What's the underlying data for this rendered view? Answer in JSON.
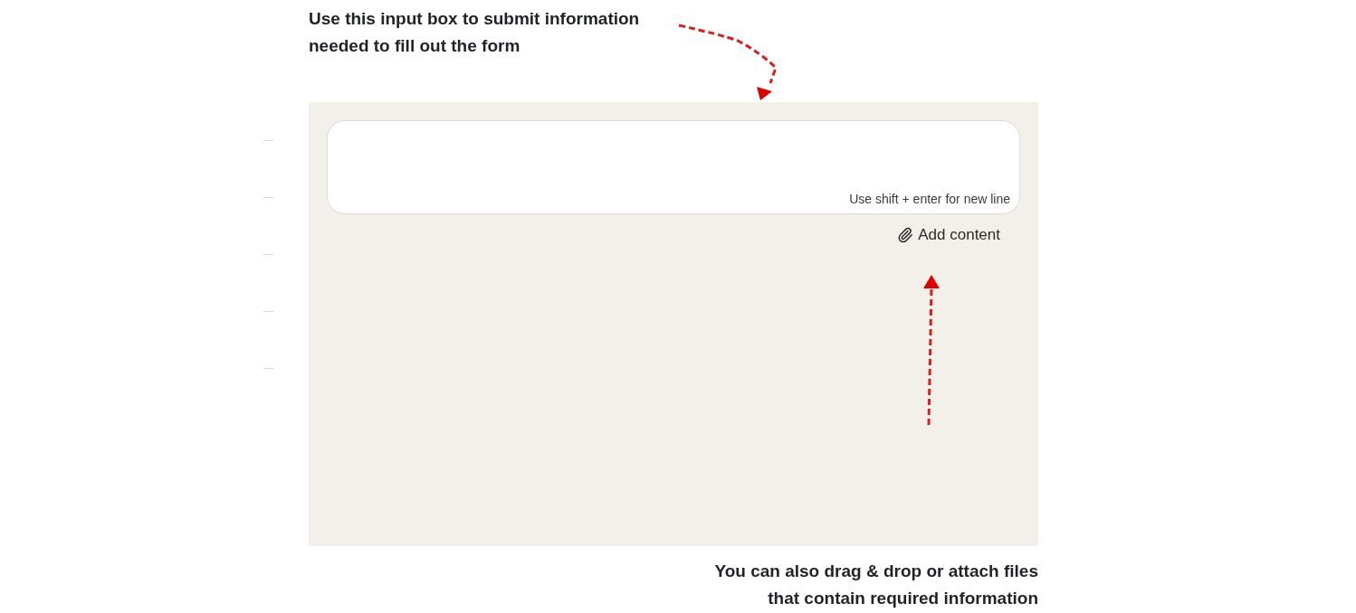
{
  "top_note": {
    "text": "Use this input box to submit information needed to fill out the form"
  },
  "composer": {
    "hint": "Use shift + enter for new line",
    "attach_button": {
      "label": "Add content"
    }
  },
  "bottom_note": {
    "text": "You can also drag & drop or attach files that contain required information"
  }
}
